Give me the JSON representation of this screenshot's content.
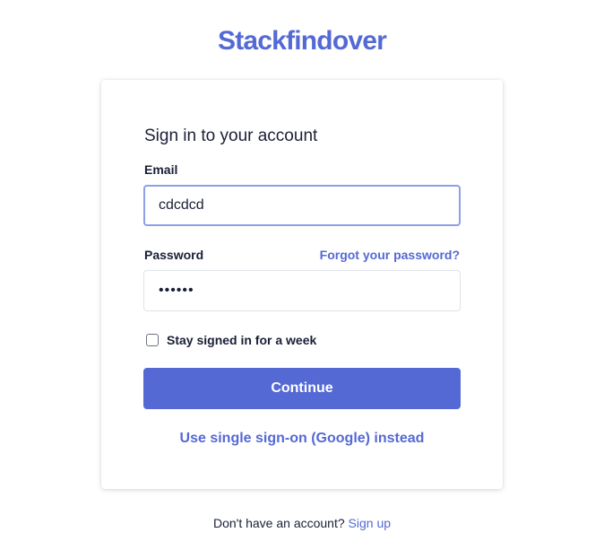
{
  "brand": {
    "name": "Stackfindover",
    "accent_color": "#5469d4"
  },
  "card": {
    "title": "Sign in to your account"
  },
  "email": {
    "label": "Email",
    "value": "cdcdcd",
    "placeholder": ""
  },
  "password": {
    "label": "Password",
    "value": "••••••",
    "forgot_label": "Forgot your password?"
  },
  "remember": {
    "label": "Stay signed in for a week",
    "checked": false
  },
  "actions": {
    "continue_label": "Continue",
    "sso_label": "Use single sign-on (Google) instead"
  },
  "footer": {
    "prompt": "Don't have an account?",
    "signup_label": "Sign up"
  }
}
